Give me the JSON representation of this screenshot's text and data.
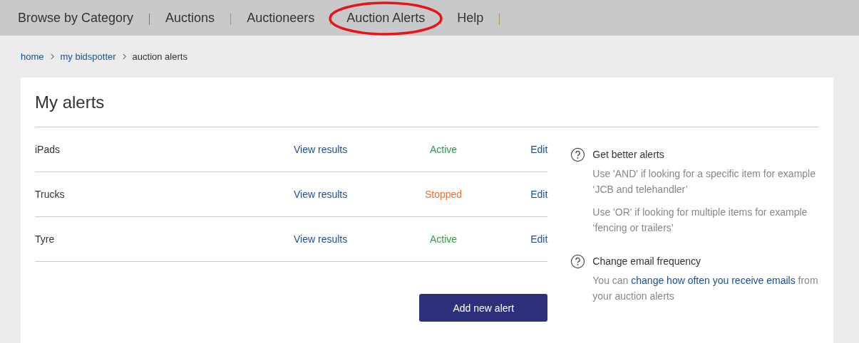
{
  "nav": [
    {
      "label": "Browse by Category",
      "circled": false
    },
    {
      "label": "Auctions",
      "circled": false
    },
    {
      "label": "Auctioneers",
      "circled": false
    },
    {
      "label": "Auction Alerts",
      "circled": true
    },
    {
      "label": "Help",
      "circled": false
    }
  ],
  "breadcrumb": [
    {
      "label": "home",
      "link": true
    },
    {
      "label": "my bidspotter",
      "link": true
    },
    {
      "label": "auction alerts",
      "link": false
    }
  ],
  "title": "My alerts",
  "alerts": [
    {
      "name": "iPads",
      "view": "View results",
      "status": "Active",
      "kind": "active",
      "edit": "Edit"
    },
    {
      "name": "Trucks",
      "view": "View results",
      "status": "Stopped",
      "kind": "stopped",
      "edit": "Edit"
    },
    {
      "name": "Tyre",
      "view": "View results",
      "status": "Active",
      "kind": "active",
      "edit": "Edit"
    }
  ],
  "add_button": "Add new alert",
  "help": [
    {
      "heading": "Get better alerts",
      "paragraphs": [
        [
          {
            "text": "Use 'AND' if looking for a specific item for example ‘JCB and telehandler’",
            "link": false
          }
        ],
        [
          {
            "text": "Use 'OR' if looking for multiple items for example ‘fencing or trailers’",
            "link": false
          }
        ]
      ]
    },
    {
      "heading": "Change email frequency",
      "paragraphs": [
        [
          {
            "text": "You can ",
            "link": false
          },
          {
            "text": "change how often you receive emails",
            "link": true
          },
          {
            "text": " from your auction alerts",
            "link": false
          }
        ]
      ]
    }
  ]
}
